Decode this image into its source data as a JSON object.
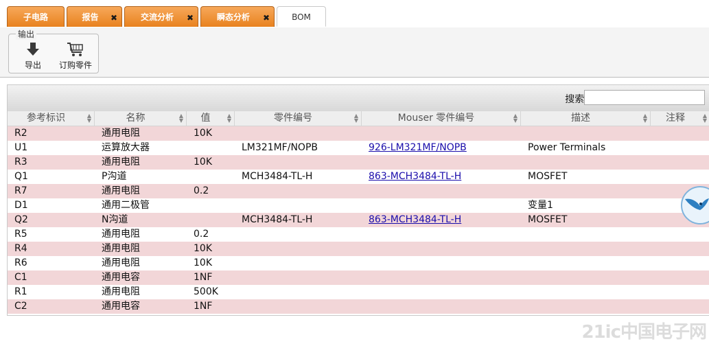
{
  "tabs": [
    {
      "label": "子电路",
      "closable": false,
      "active": false
    },
    {
      "label": "报告",
      "closable": true,
      "active": false
    },
    {
      "label": "交流分析",
      "closable": true,
      "active": false
    },
    {
      "label": "瞬态分析",
      "closable": true,
      "active": false
    },
    {
      "label": "BOM",
      "closable": false,
      "active": true
    }
  ],
  "tab_close_glyph": "✖",
  "toolbar": {
    "group_title": "输出",
    "export_label": "导出",
    "order_label": "订购零件"
  },
  "search": {
    "label": "搜索:",
    "value": ""
  },
  "columns": [
    "参考标识",
    "名称",
    "值",
    "零件编号",
    "Mouser 零件编号",
    "描述",
    "注释"
  ],
  "rows": [
    {
      "ref": "R2",
      "name": "通用电阻",
      "value": "10K",
      "part": "",
      "mouser": "",
      "desc": "",
      "note": ""
    },
    {
      "ref": "U1",
      "name": "运算放大器",
      "value": "",
      "part": "LM321MF/NOPB",
      "mouser": "926-LM321MF/NOPB",
      "desc": "Power Terminals",
      "note": ""
    },
    {
      "ref": "R3",
      "name": "通用电阻",
      "value": "10K",
      "part": "",
      "mouser": "",
      "desc": "",
      "note": ""
    },
    {
      "ref": "Q1",
      "name": "P沟道",
      "value": "",
      "part": "MCH3484-TL-H",
      "mouser": "863-MCH3484-TL-H",
      "desc": "MOSFET",
      "note": ""
    },
    {
      "ref": "R7",
      "name": "通用电阻",
      "value": "0.2",
      "part": "",
      "mouser": "",
      "desc": "",
      "note": ""
    },
    {
      "ref": "D1",
      "name": "通用二极管",
      "value": "",
      "part": "",
      "mouser": "",
      "desc": "变量1",
      "note": ""
    },
    {
      "ref": "Q2",
      "name": "N沟道",
      "value": "",
      "part": "MCH3484-TL-H",
      "mouser": "863-MCH3484-TL-H",
      "desc": "MOSFET",
      "note": ""
    },
    {
      "ref": "R5",
      "name": "通用电阻",
      "value": "0.2",
      "part": "",
      "mouser": "",
      "desc": "",
      "note": ""
    },
    {
      "ref": "R4",
      "name": "通用电阻",
      "value": "10K",
      "part": "",
      "mouser": "",
      "desc": "",
      "note": ""
    },
    {
      "ref": "R6",
      "name": "通用电阻",
      "value": "10K",
      "part": "",
      "mouser": "",
      "desc": "",
      "note": ""
    },
    {
      "ref": "C1",
      "name": "通用电容",
      "value": "1NF",
      "part": "",
      "mouser": "",
      "desc": "",
      "note": ""
    },
    {
      "ref": "R1",
      "name": "通用电阻",
      "value": "500K",
      "part": "",
      "mouser": "",
      "desc": "",
      "note": ""
    },
    {
      "ref": "C2",
      "name": "通用电容",
      "value": "1NF",
      "part": "",
      "mouser": "",
      "desc": "",
      "note": ""
    }
  ],
  "watermark": "21ic中国电子网",
  "colors": {
    "tab_accent": "#e8821f",
    "row_stripe": "#f2d6d8",
    "link": "#1a0dab"
  },
  "icons": {
    "export": "download-arrow-icon",
    "order": "shopping-cart-icon",
    "floating": "bird-logo-icon"
  }
}
